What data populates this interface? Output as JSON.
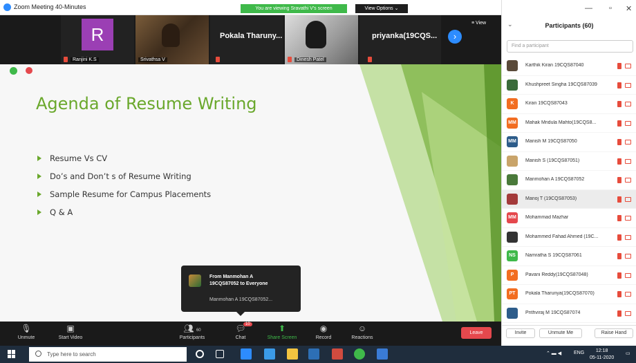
{
  "window": {
    "title": "Zoom Meeting 40-Minutes",
    "sharing_banner": "You are viewing Sravathi V's screen",
    "view_options": "View Options"
  },
  "video_strip": {
    "tiles": [
      {
        "initial": "R",
        "name": "Ranjini K.S"
      },
      {
        "name": "Srivathsa V"
      },
      {
        "big_name": "Pokala Tharuny..."
      },
      {
        "name": "Dinesh Patel"
      },
      {
        "big_name": "priyanka(19CQS..."
      }
    ],
    "view_label": "View"
  },
  "slide": {
    "title": "Agenda of Resume Writing",
    "bullets": [
      "Resume Vs CV",
      "Do’s and Don’t s of  Resume Writing",
      "Sample Resume for Campus Placements",
      "Q & A"
    ],
    "accent_color": "#6aa82c"
  },
  "chat_toast": {
    "from_line1": "From Manmohan A",
    "from_line2": "19CQS87052 to Everyone",
    "message": "Manmohan A 19CQS87052..."
  },
  "toolbar": {
    "unmute": "Unmute",
    "start_video": "Start Video",
    "participants": "Participants",
    "participants_count": "60",
    "chat": "Chat",
    "chat_badge": "10",
    "share_screen": "Share Screen",
    "record": "Record",
    "reactions": "Reactions",
    "leave": "Leave"
  },
  "participants_panel": {
    "title": "Participants (60)",
    "search_placeholder": "Find a participant",
    "participants": [
      {
        "name": "Karthik Kiran 19CQS87040",
        "initials": "",
        "color": "#5a4a3a"
      },
      {
        "name": "Khushpreet Singha 19CQS87039",
        "initials": "",
        "color": "#3a6b3a"
      },
      {
        "name": "Kiran 19CQS87043",
        "initials": "K",
        "color": "#f26d21"
      },
      {
        "name": "Mahak Mridula Mahto(19CQS8...",
        "initials": "MM",
        "color": "#f26d21"
      },
      {
        "name": "Manish M 19CQS87050",
        "initials": "MM",
        "color": "#2d5c8a"
      },
      {
        "name": "Manish S (19CQS87051)",
        "initials": "",
        "color": "#c9a46a"
      },
      {
        "name": "Manmohan A 19CQS87052",
        "initials": "",
        "color": "#4a7a3a"
      },
      {
        "name": "Manoj T (19CQS87053)",
        "initials": "",
        "color": "#a33a3a"
      },
      {
        "name": "Mohammad Mazhar",
        "initials": "MM",
        "color": "#e5484d"
      },
      {
        "name": "Mohammed Fahad Ahmed (19C...",
        "initials": "",
        "color": "#333333"
      },
      {
        "name": "Namratha S 19CQS87061",
        "initials": "NS",
        "color": "#3fb94a"
      },
      {
        "name": "Pavani Reddy(19CQS87048)",
        "initials": "P",
        "color": "#f26d21"
      },
      {
        "name": "Pokala Tharunya(19CQS87070)",
        "initials": "PT",
        "color": "#f26d21"
      },
      {
        "name": "Prithviraj M 19CQS87074",
        "initials": "",
        "color": "#2d5c8a"
      }
    ],
    "invite": "Invite",
    "unmute_me": "Unmute Me",
    "raise_hand": "Raise Hand"
  },
  "taskbar": {
    "search_placeholder": "Type here to search",
    "lang": "ENG",
    "time": "12:18",
    "date": "05-11-2020"
  }
}
